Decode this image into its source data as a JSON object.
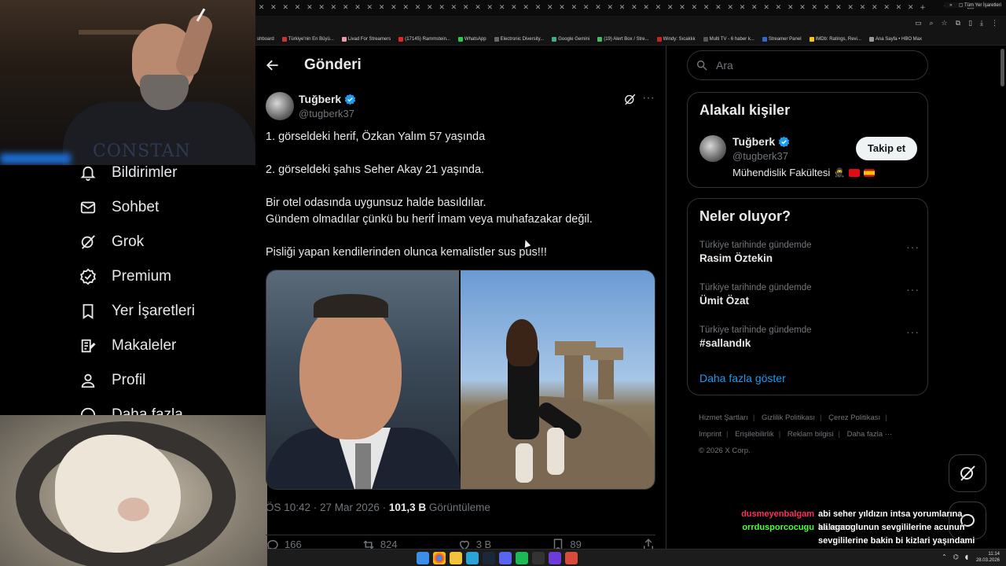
{
  "browser": {
    "bookmarks": [
      "shboard",
      "Türkiye'nin En Büyü...",
      "Livad For Streamers",
      "(17145) Rammstein...",
      "WhatsApp",
      "Electronic Diversity...",
      "Google Gemini",
      "(19) Alert Box / Stre...",
      "Windy: Sıcaklık",
      "Multi TV - 6 haber k...",
      "Streamer Panel",
      "IMDb: Ratings, Revi...",
      "Ana Sayfa • HBO Max"
    ],
    "bookmarks_overflow": "»",
    "all_bookmarks_label": "Tüm Yer İşaretleri"
  },
  "sidebar": {
    "items": [
      {
        "label": "Bildirimler",
        "icon": "bell-icon"
      },
      {
        "label": "Sohbet",
        "icon": "mail-icon"
      },
      {
        "label": "Grok",
        "icon": "grok-icon"
      },
      {
        "label": "Premium",
        "icon": "premium-icon"
      },
      {
        "label": "Yer İşaretleri",
        "icon": "bookmark-icon"
      },
      {
        "label": "Makaleler",
        "icon": "article-icon"
      },
      {
        "label": "Profil",
        "icon": "profile-icon"
      },
      {
        "label": "Daha fazla",
        "icon": "more-circle-icon"
      }
    ]
  },
  "header": {
    "title": "Gönderi"
  },
  "post": {
    "author_name": "Tuğberk",
    "author_handle": "@tugberk37",
    "lines": [
      "1. görseldeki herif, Özkan Yalım 57 yaşında",
      "",
      "2. görseldeki şahıs Seher Akay 21 yaşında.",
      "",
      "Bir otel odasında uygunsuz halde basıldılar.",
      "Gündem olmadılar çünkü bu herif İmam veya muhafazakar değil.",
      "",
      "Pisliği yapan kendilerinden olunca kemalistler sus pus!!!"
    ],
    "meta_time": "ÖS 10:42 · 27 Mar 2026 · ",
    "views_count": "101,3 B",
    "views_label": " Görüntüleme",
    "replies": "166",
    "reposts": "824",
    "likes": "3 B",
    "bookmarks": "89"
  },
  "right": {
    "search_placeholder": "Ara",
    "related": {
      "title": "Alakalı kişiler",
      "name": "Tuğberk",
      "handle": "@tugberk37",
      "bio": "Mühendislik Fakültesi",
      "follow_label": "Takip et"
    },
    "trends": {
      "title": "Neler oluyor?",
      "items": [
        {
          "context": "Türkiye tarihinde gündemde",
          "name": "Rasim Öztekin"
        },
        {
          "context": "Türkiye tarihinde gündemde",
          "name": "Ümit Özat"
        },
        {
          "context": "Türkiye tarihinde gündemde",
          "name": "#sallandık"
        }
      ],
      "show_more": "Daha fazla göster"
    },
    "footer": {
      "links": [
        "Hizmet Şartları",
        "Gizlilik Politikası",
        "Çerez Politikası",
        "Imprint",
        "Erişilebilirlik",
        "Reklam bilgisi",
        "Daha fazla ···"
      ],
      "copyright": "© 2026 X Corp."
    }
  },
  "chat": [
    {
      "user": "dusmeyenbalgam",
      "color": "#ff2f5f",
      "msg": "abi seher yıldızın intsa yorumlarına baksana"
    },
    {
      "user": "orrdusporcocugu",
      "color": "#4bff3a",
      "msg": "ali agaoglunun sevgililerine acunun sevgililerine bakin bi kizlari yaşındami degillermi"
    }
  ],
  "taskbar": {
    "time": "11:14",
    "date": "28.03.2026"
  },
  "colors": {
    "accent": "#1d9bf0",
    "bg": "#000000",
    "text": "#e7e9ea",
    "muted": "#71767b",
    "border": "#2f3336"
  }
}
